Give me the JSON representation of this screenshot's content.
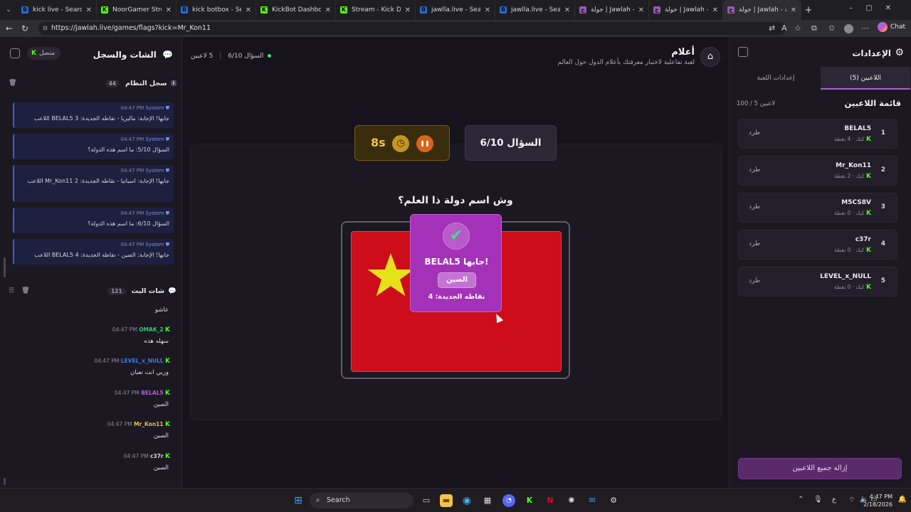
{
  "browser": {
    "tabs": [
      {
        "label": "kick live - Search",
        "fav": "B",
        "favbg": "#2b6cd6"
      },
      {
        "label": "NoorGamer Stream",
        "fav": "K",
        "favbg": "#53fc18"
      },
      {
        "label": "kick botbox - Search",
        "fav": "B",
        "favbg": "#2b6cd6"
      },
      {
        "label": "KickBot Dashboard",
        "fav": "K",
        "favbg": "#53fc18"
      },
      {
        "label": "Stream - Kick Dashb",
        "fav": "K",
        "favbg": "#53fc18"
      },
      {
        "label": "jawlla.live - Search",
        "fav": "B",
        "favbg": "#2b6cd6"
      },
      {
        "label": "jawlla.live - Search In",
        "fav": "B",
        "favbg": "#2b6cd6"
      },
      {
        "label": "جولة | Jawlah - منصة",
        "fav": "ج",
        "favbg": "#9b59b6"
      },
      {
        "label": "جولة | Jawlah - منصة",
        "fav": "ج",
        "favbg": "#9b59b6"
      },
      {
        "label": "جولة | Jawlah - منصة",
        "fav": "ج",
        "favbg": "#9b59b6"
      }
    ],
    "url": "https://jawlah.live/games/flags?kick=Mr_Kon11",
    "chat_label": "Chat"
  },
  "left": {
    "title": "الشات والسجل",
    "status": "متصل",
    "syslog_title": "سجل النظام",
    "syslog_count": "44",
    "system_messages": [
      {
        "who": "System",
        "time": "04:47 PM",
        "text": "اللاعب BELAL5 جابها! الإجابة: ماليزيا - نقاطه الجديدة: 3"
      },
      {
        "who": "System",
        "time": "04:47 PM",
        "text": "السؤال 5/10: ما اسم هذه الدولة؟"
      },
      {
        "who": "System",
        "time": "04:47 PM",
        "text": "اللاعب Mr_Kon11 جابها! الإجابة: اسبانيا - نقاطه الجديدة: 2"
      },
      {
        "who": "System",
        "time": "04:47 PM",
        "text": "السؤال 6/10: ما اسم هذه الدولة؟"
      },
      {
        "who": "System",
        "time": "04:47 PM",
        "text": "اللاعب BELAL5 جابها! الإجابة: الصين - نقاطه الجديدة: 4"
      }
    ],
    "chat_title": "شات البث",
    "chat_count": "121",
    "chat_first_text": "عاشو",
    "chat_messages": [
      {
        "user": "OMAK_2",
        "color": "#2ecc71",
        "time": "04:47 PM",
        "text": "سهله هذه"
      },
      {
        "user": "LEVEL_x_NULL",
        "color": "#3d7be0",
        "time": "04:47 PM",
        "text": "وربي انت تعبان"
      },
      {
        "user": "BELAL5",
        "color": "#b05ed6",
        "time": "04:47 PM",
        "text": "الصين"
      },
      {
        "user": "Mr_Kon11",
        "color": "#e8c14a",
        "time": "04:47 PM",
        "text": "الصين"
      },
      {
        "user": "c37r",
        "color": "#d9d6e0",
        "time": "04:47 PM",
        "text": "الصين"
      }
    ]
  },
  "center": {
    "game_title": "أعلام",
    "game_subtitle": "لعبة تفاعلية لاختبار معرفتك بأعلام الدول حول العالم",
    "players_online": "5 لاعبين",
    "question_short": "السؤال 6/10",
    "question_label": "السؤال 6/10",
    "timer": "8s",
    "pause_icon": "pause-icon",
    "question_text": "وش اسم دولة ذا العلم؟",
    "flag_colors": {
      "field": "#cd0d1a",
      "star": "#e6e21a"
    },
    "popup": {
      "winner": "BELAL5 جابها!",
      "answer": "الصين",
      "points": "نقاطه الجديدة: 4"
    }
  },
  "right": {
    "title": "الإعدادات",
    "tabs": [
      {
        "label": "اللاعبين (5)",
        "active": true
      },
      {
        "label": "إعدادات اللعبة",
        "active": false
      }
    ],
    "list_title": "قائمة اللاعبين",
    "list_count": "100 / 5 لاعبين",
    "players": [
      {
        "rank": "1",
        "name": "BELAL5",
        "meta": "كيك · 4 نقطة",
        "kick": "طرد"
      },
      {
        "rank": "2",
        "name": "Mr_Kon11",
        "meta": "كيك · 2 نقطة",
        "kick": "طرد"
      },
      {
        "rank": "3",
        "name": "M5CS8V",
        "meta": "كيك · 0 نقطة",
        "kick": "طرد"
      },
      {
        "rank": "4",
        "name": "c37r",
        "meta": "كيك · 0 نقطة",
        "kick": "طرد"
      },
      {
        "rank": "5",
        "name": "LEVEL_x_NULL",
        "meta": "كيك · 0 نقطة",
        "kick": "طرد"
      }
    ],
    "clear_all": "إزالة جميع اللاعبين"
  },
  "taskbar": {
    "search": "Search",
    "time": "4:47 PM",
    "date": "2/18/2026",
    "lang": "ع"
  }
}
